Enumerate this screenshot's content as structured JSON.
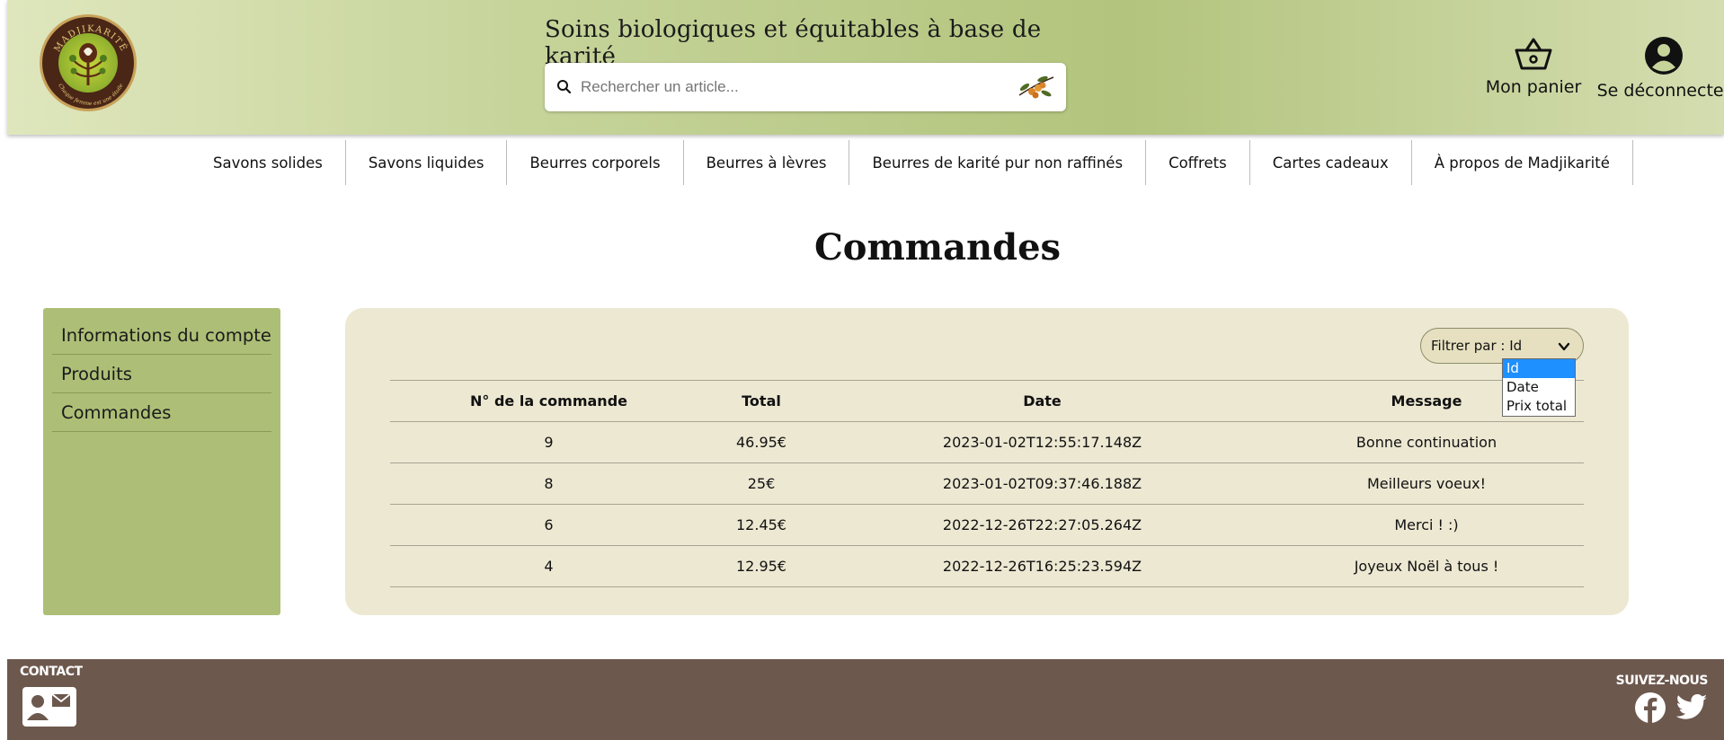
{
  "header": {
    "logo_alt": "Madjikarité",
    "tagline": "Soins biologiques et équitables à base de karité",
    "search": {
      "placeholder": "Rechercher un article...",
      "value": ""
    },
    "cart_label": "Mon panier",
    "logout_label": "Se déconnecter"
  },
  "nav": {
    "items": [
      "Savons solides",
      "Savons liquides",
      "Beurres corporels",
      "Beurres à lèvres",
      "Beurres de karité pur non raffinés",
      "Coffrets",
      "Cartes cadeaux",
      "À propos de Madjikarité"
    ]
  },
  "page": {
    "title": "Commandes"
  },
  "sidebar": {
    "items": [
      "Informations du compte",
      "Produits",
      "Commandes"
    ]
  },
  "orders": {
    "filter": {
      "label": "Filtrer par : Id",
      "options": [
        "Id",
        "Date",
        "Prix total"
      ],
      "selected": "Id"
    },
    "columns": [
      "N° de la commande",
      "Total",
      "Date",
      "Message"
    ],
    "rows": [
      [
        "9",
        "46.95€",
        "2023-01-02T12:55:17.148Z",
        "Bonne continuation"
      ],
      [
        "8",
        "25€",
        "2023-01-02T09:37:46.188Z",
        "Meilleurs voeux!"
      ],
      [
        "6",
        "12.45€",
        "2022-12-26T22:27:05.264Z",
        "Merci ! :)"
      ],
      [
        "4",
        "12.95€",
        "2022-12-26T16:25:23.594Z",
        "Joyeux Noël à tous !"
      ]
    ]
  },
  "footer": {
    "contact_label": "CONTACT",
    "follow_label": "SUIVEZ-NOUS"
  },
  "colors": {
    "header_green": "#c6d49a",
    "sidebar_green": "#adbf76",
    "panel_beige": "#ede8d2",
    "footer_brown": "#6d584e",
    "dropdown_selected": "#1e90ff"
  },
  "icons": {
    "search": "search-icon",
    "cart": "basket-icon",
    "logout": "user-circle-icon",
    "filter": "chevron-down-icon",
    "contact": "contact-card-icon",
    "facebook": "facebook-icon",
    "twitter": "twitter-icon"
  }
}
